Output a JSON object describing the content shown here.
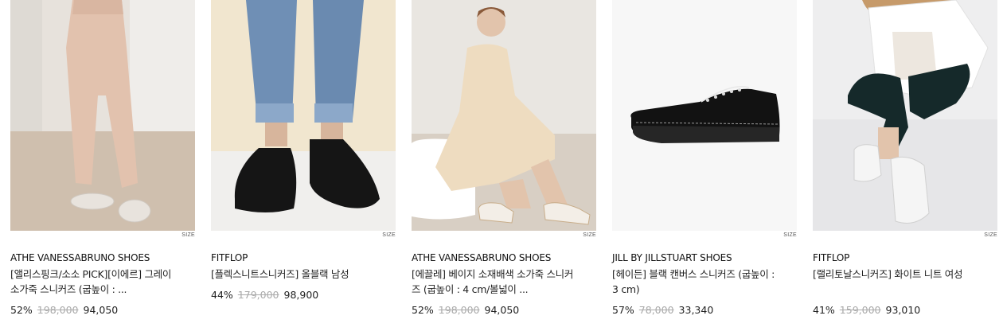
{
  "size_label": "SIZE",
  "products": [
    {
      "brand": "ATHE VANESSABRUNO SHOES",
      "name": "[앨리스핑크/소소 PICK][이에르] 그레이 소가죽 스니커즈 (굽높이 : ...",
      "discount": "52%",
      "original_price": "198,000",
      "sale_price": "94,050",
      "image": "model-pink-pants-gray-sneakers"
    },
    {
      "brand": "FITFLOP",
      "name": "[플렉스니트스니커즈] 올블랙 남성",
      "discount": "44%",
      "original_price": "179,000",
      "sale_price": "98,900",
      "image": "jeans-black-knit-sneakers"
    },
    {
      "brand": "ATHE VANESSABRUNO SHOES",
      "name": "[에끌레] 베이지 소재배색 소가죽 스니커즈 (굽높이 : 4 cm/볼넓이 ...",
      "discount": "52%",
      "original_price": "198,000",
      "sale_price": "94,050",
      "image": "seated-model-beige-sneakers"
    },
    {
      "brand": "JILL BY JILLSTUART SHOES",
      "name": "[헤이든] 블랙 캔버스 스니커즈 (굽높이 : 3 cm)",
      "discount": "57%",
      "original_price": "78,000",
      "sale_price": "33,340",
      "image": "black-canvas-sneaker"
    },
    {
      "brand": "FITFLOP",
      "name": "[랠리토날스니커즈] 화이트 니트 여성",
      "discount": "41%",
      "original_price": "159,000",
      "sale_price": "93,010",
      "image": "seated-model-white-sneakers"
    }
  ]
}
